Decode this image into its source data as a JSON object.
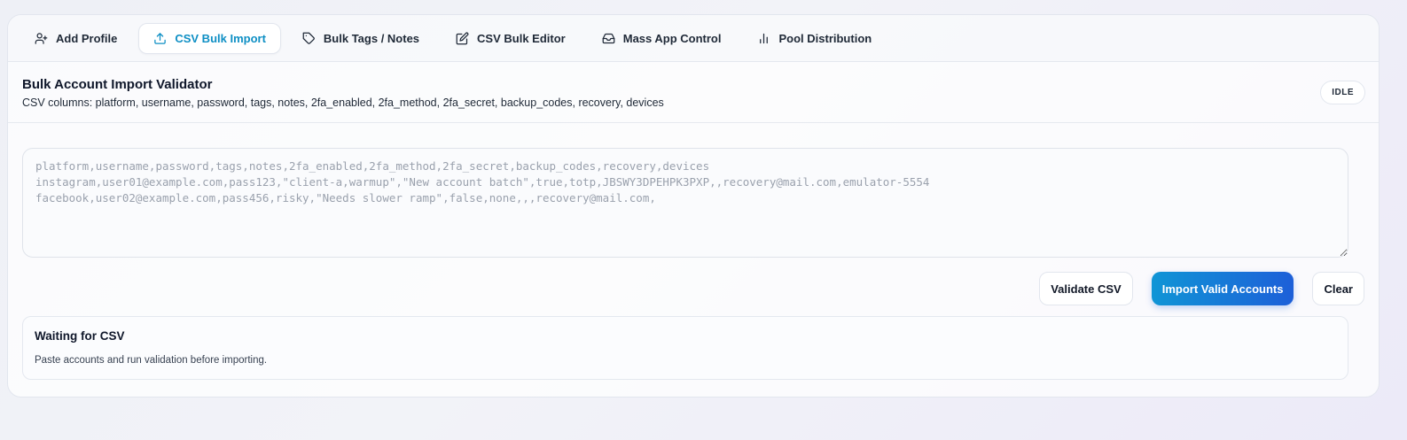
{
  "tabs": [
    {
      "label": "Add Profile",
      "icon": "user-plus-icon",
      "active": false
    },
    {
      "label": "CSV Bulk Import",
      "icon": "upload-icon",
      "active": true
    },
    {
      "label": "Bulk Tags / Notes",
      "icon": "tag-icon",
      "active": false
    },
    {
      "label": "CSV Bulk Editor",
      "icon": "edit-icon",
      "active": false
    },
    {
      "label": "Mass App Control",
      "icon": "inbox-icon",
      "active": false
    },
    {
      "label": "Pool Distribution",
      "icon": "bar-chart-icon",
      "active": false
    }
  ],
  "header": {
    "title": "Bulk Account Import Validator",
    "subtitle": "CSV columns: platform, username, password, tags, notes, 2fa_enabled, 2fa_method, 2fa_secret, backup_codes, recovery, devices",
    "status_badge": "IDLE"
  },
  "csv_input": {
    "value": "",
    "placeholder": "platform,username,password,tags,notes,2fa_enabled,2fa_method,2fa_secret,backup_codes,recovery,devices\ninstagram,user01@example.com,pass123,\"client-a,warmup\",\"New account batch\",true,totp,JBSWY3DPEHPK3PXP,,recovery@mail.com,emulator-5554\nfacebook,user02@example.com,pass456,risky,\"Needs slower ramp\",false,none,,,recovery@mail.com,"
  },
  "actions": {
    "validate_label": "Validate CSV",
    "import_label": "Import Valid Accounts",
    "clear_label": "Clear"
  },
  "status_panel": {
    "title": "Waiting for CSV",
    "message": "Paste accounts and run validation before importing."
  },
  "colors": {
    "accent": "#0e8fc4",
    "primary_gradient_start": "#1095d6",
    "primary_gradient_end": "#1d5fd8"
  }
}
